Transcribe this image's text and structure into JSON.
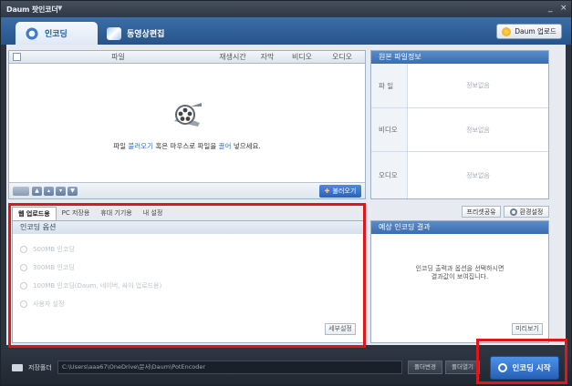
{
  "window": {
    "title": "Daum 팟인코더",
    "min": "_",
    "close": "×"
  },
  "tabs": [
    {
      "label": "인코딩"
    },
    {
      "label": "동영상편집"
    }
  ],
  "daum_upload": "Daum 업로드",
  "filelist": {
    "columns": [
      "파일",
      "재생시간",
      "자막",
      "비디오",
      "오디오"
    ],
    "drop_pre": "파일 ",
    "drop_hl1": "불러오기",
    "drop_mid": " 혹은 마우스로 파일을 ",
    "drop_hl2": "끌어",
    "drop_post": " 넣으세요.",
    "add_button": "불러오기"
  },
  "source_info": {
    "header": "원본 파일정보",
    "rows": [
      {
        "key": "파 일",
        "value": "정보없음"
      },
      {
        "key": "비디오",
        "value": "정보없음"
      },
      {
        "key": "오디오",
        "value": "정보없음"
      }
    ]
  },
  "option_tabs": [
    "웹 업로드용",
    "PC 저장용",
    "휴대 기기용",
    "내 설정"
  ],
  "options": {
    "header": "인코딩 옵션",
    "items": [
      "500MB 인코딩",
      "300MB 인코딩",
      "100MB 인코딩(Daum, 네이버, 싸이 업로드용)",
      "사용자 설정"
    ],
    "detail_button": "세부설정"
  },
  "share_button": "프리셋공유",
  "env_button": "환경설정",
  "result": {
    "header": "예상 인코딩 결과",
    "message_line1": "인코딩 출력과 옵션을 선택하시면",
    "message_line2": "결과값이 보여집니다.",
    "preview_button": "미리보기"
  },
  "bottom": {
    "save_label": "저장폴더",
    "path": "C:\\Users\\aaa67\\OneDrive\\문서\\Daum\\PotEncoder",
    "change_folder": "폴더변경",
    "open_folder": "폴더열기",
    "start_button": "인코딩 시작"
  }
}
